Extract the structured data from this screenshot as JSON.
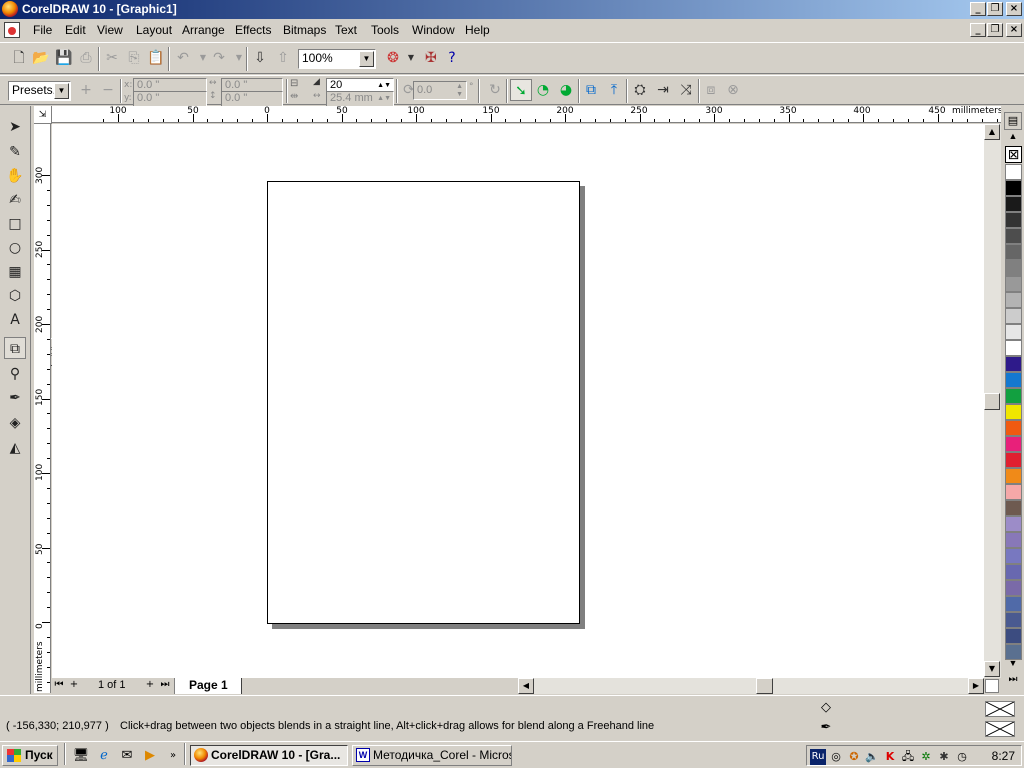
{
  "window": {
    "title": "CorelDRAW 10 - [Graphic1]"
  },
  "menu": [
    "File",
    "Edit",
    "View",
    "Layout",
    "Arrange",
    "Effects",
    "Bitmaps",
    "Text",
    "Tools",
    "Window",
    "Help"
  ],
  "standard_toolbar": {
    "zoom": "100%"
  },
  "property_bar": {
    "presets": "Presets...",
    "x_label": "x:",
    "y_label": "y:",
    "x": "0.0 \"",
    "y": "0.0 \"",
    "width": "0.0 \"",
    "height": "0.0 \"",
    "steps": "20",
    "spacing": "25.4 mm",
    "angle": "0.0",
    "angle_unit": "°"
  },
  "rulers": {
    "units": "millimeters",
    "h_labels": [
      "100",
      "50",
      "0",
      "50",
      "100",
      "150",
      "200",
      "250",
      "300",
      "350",
      "400",
      "450"
    ],
    "v_labels": [
      "300",
      "250",
      "200",
      "150",
      "100",
      "50",
      "0"
    ],
    "corner": "⇲"
  },
  "page_nav": {
    "count": "1 of 1",
    "tab": "Page 1"
  },
  "status": {
    "coords": "( -156,330; 210,977 )",
    "hint": "Click+drag between two objects blends in a straight line, Alt+click+drag allows for blend along a Freehand line"
  },
  "palette_colors": [
    "#ffffff",
    "#000000",
    "#1a1a1a",
    "#333333",
    "#4d4d4d",
    "#666666",
    "#808080",
    "#999999",
    "#b3b3b3",
    "#cccccc",
    "#e6e6e6",
    "#ffffff",
    "#2e1a8a",
    "#1478d0",
    "#12a040",
    "#f0e600",
    "#f05a10",
    "#e8207a",
    "#e02030",
    "#f08a18",
    "#f5a8a8",
    "#6e5a50",
    "#9c8cc8",
    "#8878b8",
    "#7878c0",
    "#6868b0",
    "#7a6aa8",
    "#506aa8",
    "#4a5a90",
    "#3c4c80",
    "#5a7090"
  ],
  "taskbar": {
    "start": "Пуск",
    "tasks": [
      "CorelDRAW 10 - [Gra...",
      "Методичка_Corel - Micros..."
    ],
    "lang": "Ru",
    "clock": "8:27"
  }
}
